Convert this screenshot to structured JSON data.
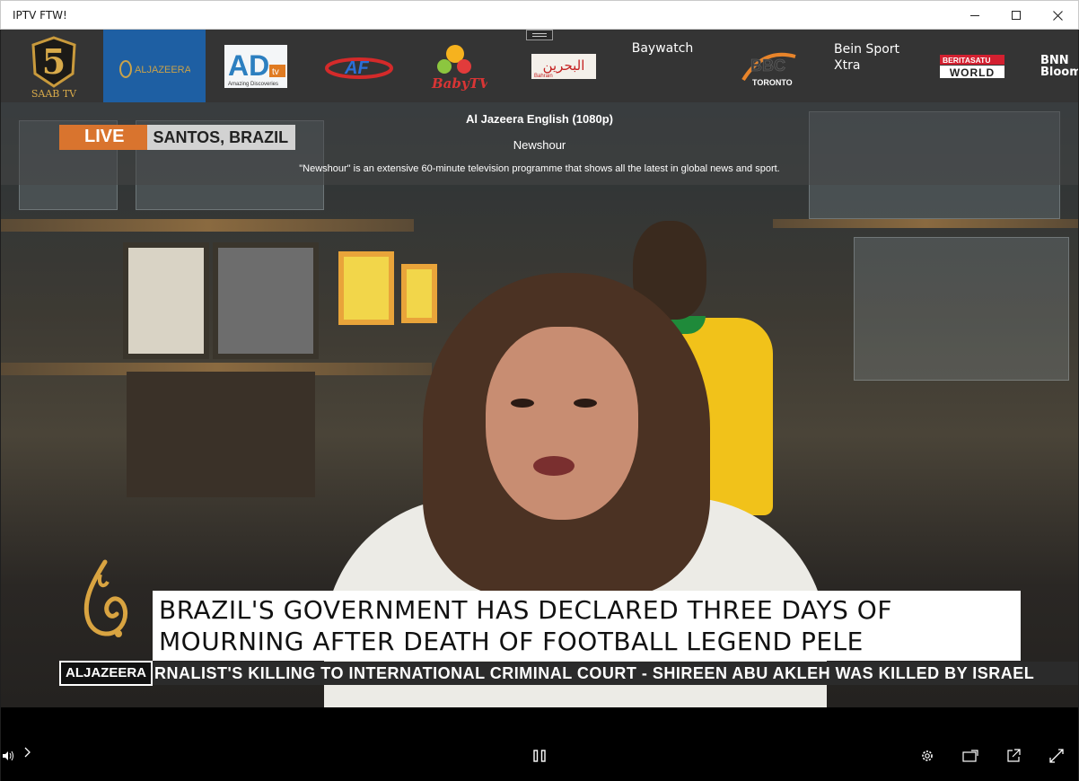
{
  "window": {
    "title": "IPTV FTW!"
  },
  "channels": [
    {
      "id": "home",
      "label": "SAAB TV",
      "numeral": "5",
      "selected": false
    },
    {
      "id": "aljazeera",
      "label": "ALJAZEERA",
      "selected": true
    },
    {
      "id": "adtv",
      "label": "AD",
      "sub": "tv",
      "tagline": "Amazing Discoveries",
      "selected": false
    },
    {
      "id": "af",
      "label": "AF",
      "selected": false
    },
    {
      "id": "babytv",
      "label": "BabyTV",
      "selected": false
    },
    {
      "id": "bahrain",
      "label": "البحرين",
      "sub": "Bahrain",
      "selected": false
    },
    {
      "id": "baywatch",
      "label": "Baywatch",
      "selected": false
    },
    {
      "id": "bbc-toronto",
      "label": "BBC",
      "sub": "TORONTO",
      "selected": false
    },
    {
      "id": "bein",
      "label": "Bein Sport Xtra",
      "selected": false
    },
    {
      "id": "beritasatu",
      "label": "BERITASATU",
      "sub": "WORLD",
      "selected": false
    },
    {
      "id": "bloomberg",
      "label": "BNN Bloom",
      "selected": false
    }
  ],
  "now_playing": {
    "channel": "Al Jazeera English (1080p)",
    "program": "Newshour",
    "description": "\"Newshour\" is an extensive 60-minute television programme that shows all the latest in global news and sport."
  },
  "broadcast": {
    "live_tag": "LIVE",
    "location": "SANTOS, BRAZIL",
    "headline_line1": "BRAZIL'S GOVERNMENT HAS DECLARED THREE DAYS OF",
    "headline_line2": "MOURNING AFTER DEATH OF FOOTBALL LEGEND PELE",
    "ticker_brand": "ALJAZEERA",
    "ticker": "RNALIST'S KILLING TO INTERNATIONAL CRIMINAL COURT   -   SHIREEN ABU AKLEH WAS KILLED BY ISRAEL"
  },
  "controls": {
    "volume_icon": "volume-icon",
    "expand_icon": "chevron-right-icon",
    "pause_icon": "pause-icon",
    "settings_icon": "gear-icon",
    "cast_icon": "cast-icon",
    "popout_icon": "popout-icon",
    "fullscreen_icon": "fullscreen-icon"
  },
  "colors": {
    "selected_channel": "#1e5fa3",
    "strip": "#343434",
    "live_tag": "#d9742e"
  }
}
